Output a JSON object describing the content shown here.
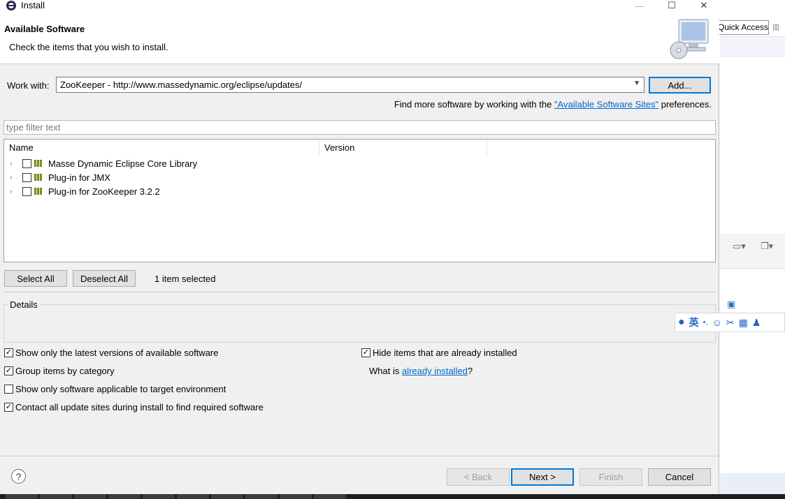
{
  "window": {
    "title": "Install",
    "minimize_glyph": "—",
    "maximize_glyph": "☐",
    "close_glyph": "✕"
  },
  "header": {
    "title": "Available Software",
    "subtitle": "Check the items that you wish to install."
  },
  "work_with": {
    "label": "Work with:",
    "value": "ZooKeeper - http://www.massedynamic.org/eclipse/updates/",
    "add_label": "Add..."
  },
  "find_more": {
    "prefix": "Find more software by working with the ",
    "link": "\"Available Software Sites\"",
    "suffix": " preferences."
  },
  "filter": {
    "placeholder": "type filter text"
  },
  "tree": {
    "columns": [
      "Name",
      "Version"
    ],
    "items": [
      {
        "label": "Masse Dynamic Eclipse Core Library"
      },
      {
        "label": "Plug-in for JMX"
      },
      {
        "label": "Plug-in for ZooKeeper 3.2.2"
      }
    ]
  },
  "selection": {
    "select_all": "Select All",
    "deselect_all": "Deselect All",
    "status": "1 item selected"
  },
  "details": {
    "label": "Details"
  },
  "options": {
    "latest_versions": "Show only the latest versions of available software",
    "group_by_category": "Group items by category",
    "target_env": "Show only software applicable to target environment",
    "contact_sites": "Contact all update sites during install to find required software",
    "hide_installed": "Hide items that are already installed",
    "what_is_prefix": "What is ",
    "what_is_link": "already installed",
    "what_is_suffix": "?"
  },
  "footer": {
    "help": "?",
    "back": "< Back",
    "next": "Next >",
    "finish": "Finish",
    "cancel": "Cancel"
  },
  "background": {
    "quick_access": "Quick Access"
  },
  "ime": {
    "lang": "英"
  }
}
